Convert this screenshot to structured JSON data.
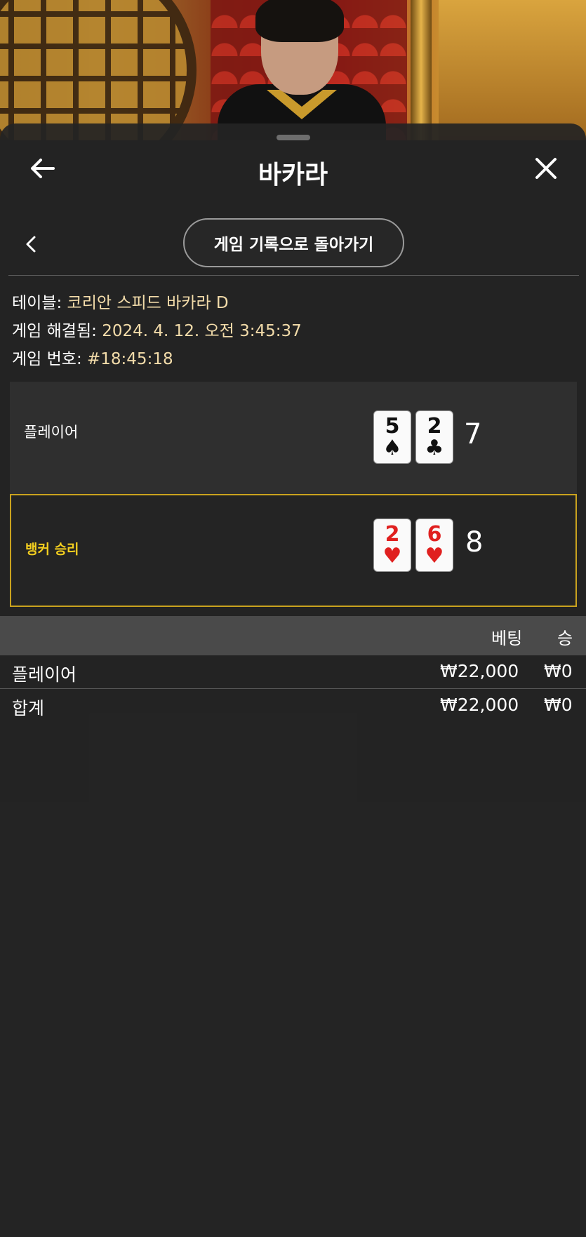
{
  "header": {
    "title": "바카라"
  },
  "back_to_history_label": "게임 기록으로 돌아가기",
  "info": {
    "table_label": "테이블:",
    "table_value": "코리안 스피드 바카라 D",
    "resolved_label": "게임 해결됨:",
    "resolved_value": "2024. 4. 12. 오전 3:45:37",
    "number_label": "게임 번호:",
    "number_value": "#18:45:18"
  },
  "results": {
    "player": {
      "label": "플레이어",
      "cards": [
        {
          "rank": "5",
          "suit": "♠",
          "color": "black"
        },
        {
          "rank": "2",
          "suit": "♣",
          "color": "black"
        }
      ],
      "score": "7"
    },
    "banker": {
      "label": "뱅커 승리",
      "cards": [
        {
          "rank": "2",
          "suit": "♥",
          "color": "red"
        },
        {
          "rank": "6",
          "suit": "♥",
          "color": "red"
        }
      ],
      "score": "8"
    }
  },
  "bets": {
    "headers": {
      "bet": "베팅",
      "win": "승"
    },
    "rows": [
      {
        "name": "플레이어",
        "bet": "₩22,000",
        "win": "₩0"
      },
      {
        "name": "합계",
        "bet": "₩22,000",
        "win": "₩0"
      }
    ]
  },
  "colors": {
    "accent_gold": "#c9a21e",
    "banker_win_text": "#f4cf1f",
    "info_value": "#f3dcaa",
    "card_red": "#e0201f"
  },
  "icons": {
    "back": "arrow-left-icon",
    "close": "close-icon",
    "sub_back": "chevron-left-icon"
  }
}
